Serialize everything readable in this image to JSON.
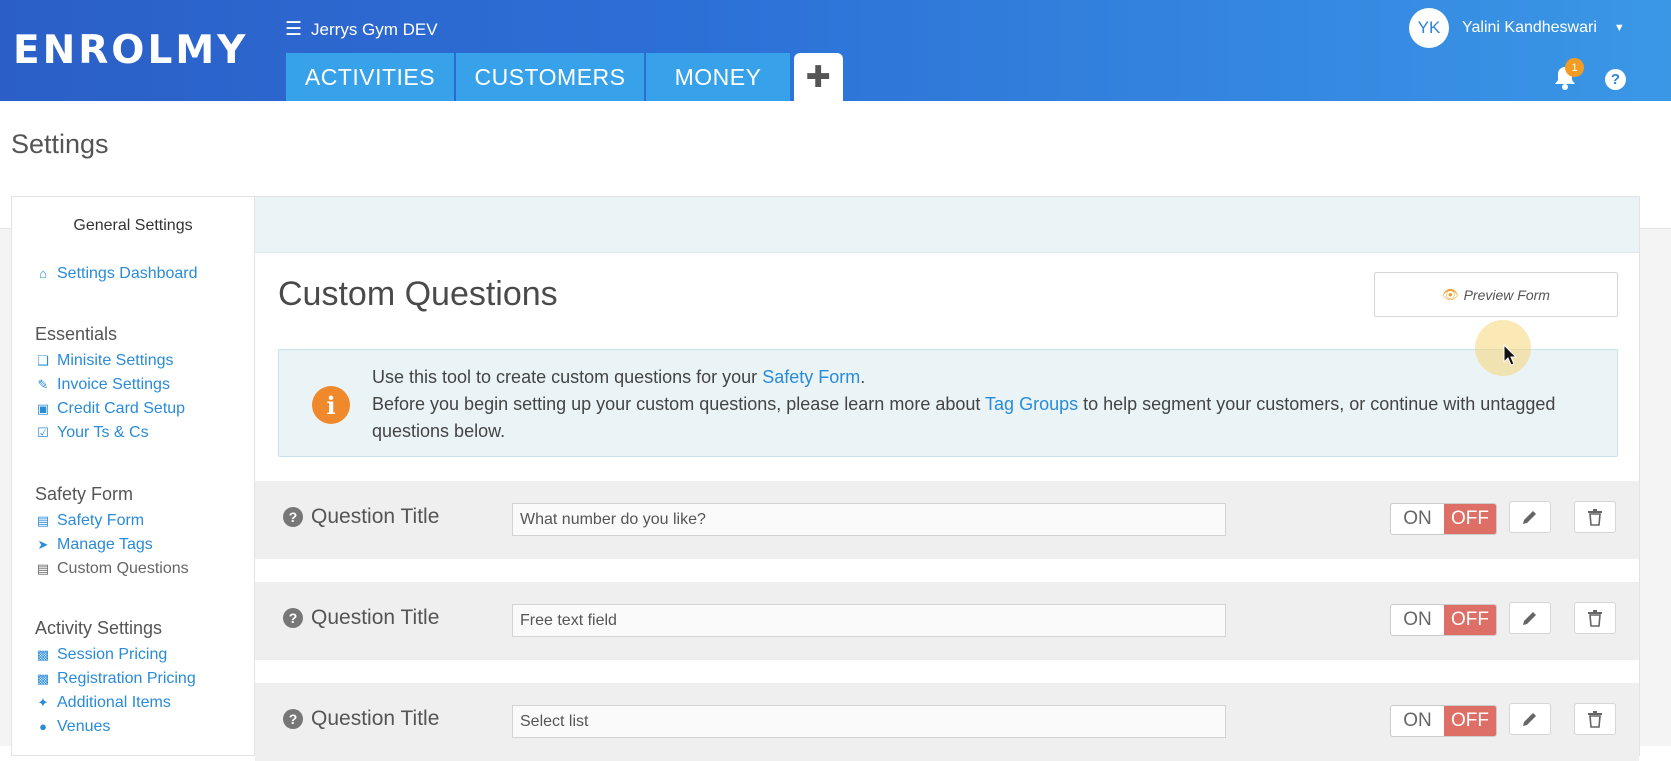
{
  "brand": {
    "logo": "ENROLMY"
  },
  "header": {
    "org_name": "Jerrys Gym DEV",
    "tabs": [
      {
        "label": "ACTIVITIES"
      },
      {
        "label": "CUSTOMERS"
      },
      {
        "label": "MONEY"
      },
      {
        "label": "✚"
      }
    ],
    "user": {
      "initials": "YK",
      "name": "Yalini Kandheswari"
    },
    "notifications": {
      "count": "1"
    },
    "help": "?"
  },
  "page": {
    "title": "Settings"
  },
  "sidebar": {
    "heading": "General Settings",
    "dashboard": {
      "label": "Settings Dashboard",
      "icon": "home-icon"
    },
    "sections": [
      {
        "title": "Essentials",
        "items": [
          {
            "label": "Minisite Settings",
            "icon": "cube-icon"
          },
          {
            "label": "Invoice Settings",
            "icon": "pencil-icon"
          },
          {
            "label": "Credit Card Setup",
            "icon": "money-icon"
          },
          {
            "label": "Your Ts & Cs",
            "icon": "check-square-icon"
          }
        ]
      },
      {
        "title": "Safety Form",
        "items": [
          {
            "label": "Safety Form",
            "icon": "file-icon"
          },
          {
            "label": "Manage Tags",
            "icon": "tags-icon"
          },
          {
            "label": "Custom Questions",
            "icon": "file-icon",
            "current": true
          }
        ]
      },
      {
        "title": "Activity Settings",
        "items": [
          {
            "label": "Session Pricing",
            "icon": "briefcase-icon"
          },
          {
            "label": "Registration Pricing",
            "icon": "briefcase-icon"
          },
          {
            "label": "Additional Items",
            "icon": "puzzle-icon"
          },
          {
            "label": "Venues",
            "icon": "map-marker-icon"
          }
        ]
      }
    ]
  },
  "main": {
    "title": "Custom Questions",
    "preview_button": "Preview Form",
    "info": {
      "line1_prefix": "Use this tool to create custom questions for your ",
      "line1_link": "Safety Form",
      "line1_suffix": ".",
      "line2_prefix": "Before you begin setting up your custom questions, please learn more about ",
      "line2_link": "Tag Groups",
      "line2_suffix": " to help segment your customers, or continue with untagged questions below."
    },
    "questions": [
      {
        "label": "Question Title",
        "value": "What number do you like?",
        "on": "ON",
        "off": "OFF"
      },
      {
        "label": "Question Title",
        "value": "Free text field",
        "on": "ON",
        "off": "OFF"
      },
      {
        "label": "Question Title",
        "value": "Select list",
        "on": "ON",
        "off": "OFF"
      }
    ]
  },
  "colors": {
    "header_start": "#2b5fc7",
    "header_end": "#3a97e6",
    "tab": "#37a2ea",
    "link": "#2a8bd7",
    "off_toggle": "#de6f66",
    "accent_orange": "#f0882c",
    "info_bg": "#eaf4f7"
  }
}
